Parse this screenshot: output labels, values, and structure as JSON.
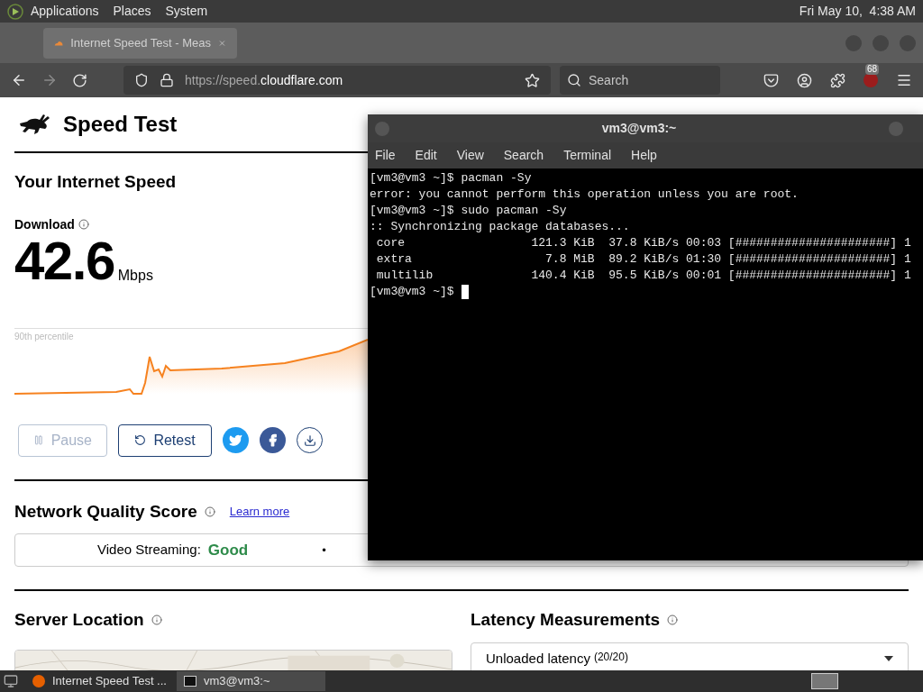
{
  "top_panel": {
    "menus": [
      "Applications",
      "Places",
      "System"
    ],
    "clock": "Fri May 10,  4:38 AM"
  },
  "browser": {
    "tab": {
      "title": "Internet Speed Test - Meas",
      "selected": true
    },
    "url_prefix": "https://speed.",
    "url_domain": "cloudflare.com",
    "search_placeholder": "Search",
    "extension_badge": "68"
  },
  "page": {
    "title": "Speed Test",
    "speed_heading": "Your Internet Speed",
    "download_label": "Download",
    "download_value": "42.6",
    "download_unit": "Mbps",
    "chart_label": "90th percentile",
    "buttons": [
      {
        "kind": "pause",
        "label": "Pause",
        "disabled": true
      },
      {
        "kind": "retest",
        "label": "Retest",
        "disabled": false
      }
    ],
    "network_quality": {
      "title": "Network Quality Score",
      "link": "Learn more",
      "items": [
        {
          "label": "Video Streaming:",
          "rating": "Good",
          "color": "#2e8b4a"
        }
      ],
      "separator": "•"
    },
    "server_location": {
      "title": "Server Location"
    },
    "latency": {
      "title": "Latency Measurements",
      "dropdown": "Unloaded latency",
      "count": "(20/20)"
    }
  },
  "terminal": {
    "title": "vm3@vm3:~",
    "menus": [
      "File",
      "Edit",
      "View",
      "Search",
      "Terminal",
      "Help"
    ],
    "lines": [
      "[vm3@vm3 ~]$ pacman -Sy",
      "error: you cannot perform this operation unless you are root.",
      "[vm3@vm3 ~]$ sudo pacman -Sy",
      ":: Synchronizing package databases...",
      " core                  121.3 KiB  37.8 KiB/s 00:03 [######################] 1",
      " extra                   7.8 MiB  89.2 KiB/s 01:30 [######################] 1",
      " multilib              140.4 KiB  95.5 KiB/s 00:01 [######################] 1",
      "[vm3@vm3 ~]$"
    ],
    "cursor": true
  },
  "taskbar": {
    "items": [
      {
        "kind": "browser",
        "label": "Internet Speed Test ...",
        "selected": false
      },
      {
        "kind": "terminal",
        "label": "vm3@vm3:~",
        "selected": true
      }
    ]
  }
}
